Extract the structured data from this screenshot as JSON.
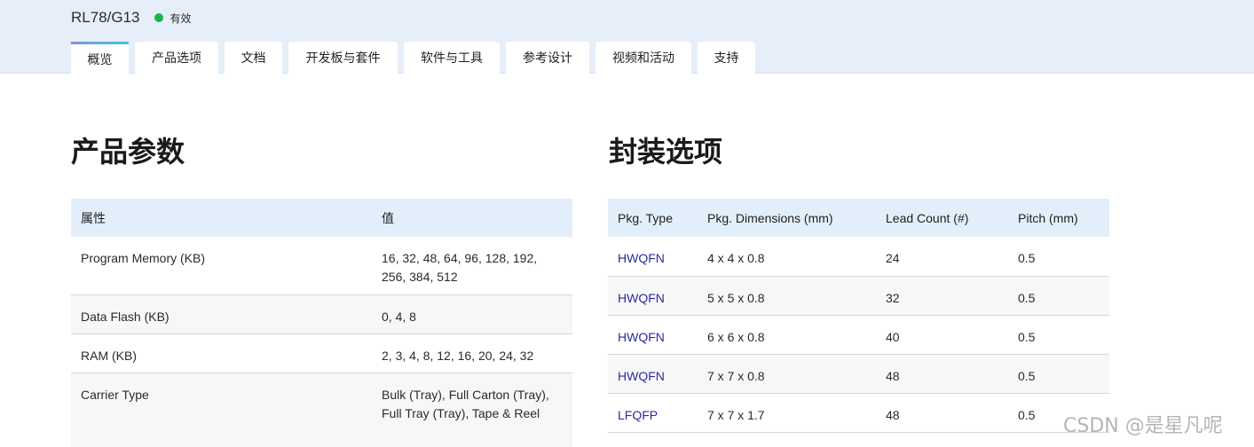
{
  "header": {
    "product_name": "RL78/G13",
    "status": "有效",
    "status_color": "#1db44a",
    "tabs": [
      {
        "label": "概览",
        "active": true
      },
      {
        "label": "产品选项",
        "active": false
      },
      {
        "label": "文档",
        "active": false
      },
      {
        "label": "开发板与套件",
        "active": false
      },
      {
        "label": "软件与工具",
        "active": false
      },
      {
        "label": "参考设计",
        "active": false
      },
      {
        "label": "视频和活动",
        "active": false
      },
      {
        "label": "支持",
        "active": false
      }
    ]
  },
  "params": {
    "title": "产品参数",
    "columns": [
      "属性",
      "值"
    ],
    "rows": [
      {
        "attr": "Program Memory (KB)",
        "value": "16, 32, 48, 64, 96, 128, 192, 256, 384, 512"
      },
      {
        "attr": "Data Flash (KB)",
        "value": "0, 4, 8"
      },
      {
        "attr": "RAM (KB)",
        "value": "2, 3, 4, 8, 12, 16, 20, 24, 32"
      },
      {
        "attr": "Carrier Type",
        "value": "Bulk (Tray), Full Carton (Tray), Full Tray (Tray), Tape & Reel"
      }
    ]
  },
  "packages": {
    "title": "封装选项",
    "columns": [
      "Pkg. Type",
      "Pkg. Dimensions (mm)",
      "Lead Count (#)",
      "Pitch (mm)"
    ],
    "rows": [
      {
        "type": "HWQFN",
        "dims": "4 x 4 x 0.8",
        "leads": "24",
        "pitch": "0.5"
      },
      {
        "type": "HWQFN",
        "dims": "5 x 5 x 0.8",
        "leads": "32",
        "pitch": "0.5"
      },
      {
        "type": "HWQFN",
        "dims": "6 x 6 x 0.8",
        "leads": "40",
        "pitch": "0.5"
      },
      {
        "type": "HWQFN",
        "dims": "7 x 7 x 0.8",
        "leads": "48",
        "pitch": "0.5"
      },
      {
        "type": "LFQFP",
        "dims": "7 x 7 x 1.7",
        "leads": "48",
        "pitch": "0.5"
      }
    ]
  },
  "watermark": "CSDN @是星凡呢"
}
